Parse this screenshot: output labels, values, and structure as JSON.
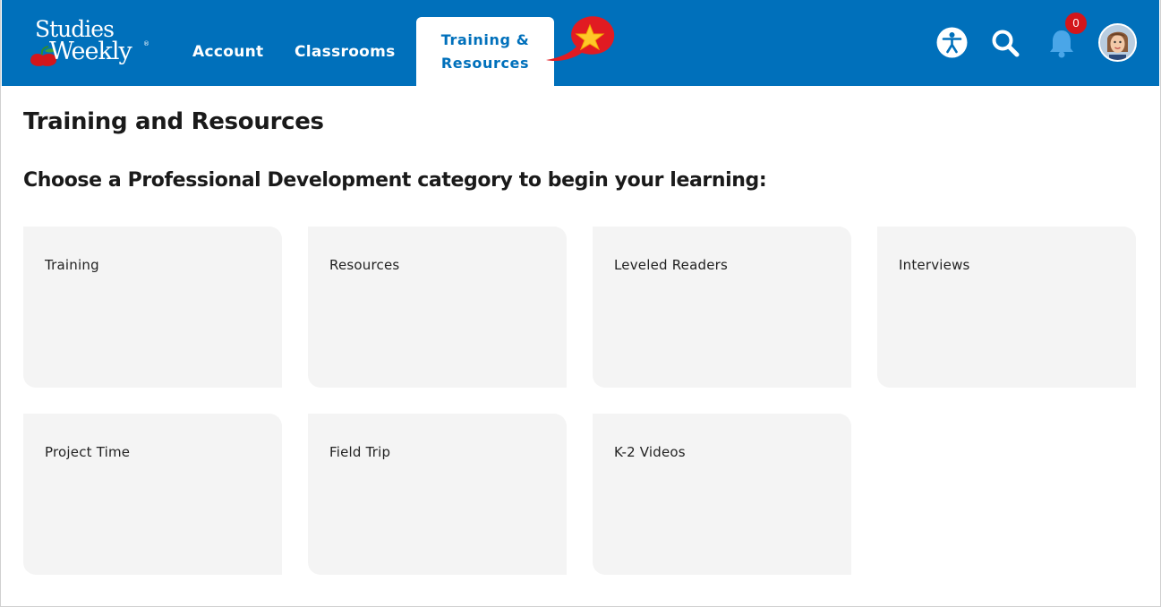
{
  "brand": {
    "line1": "Studies",
    "line2": "Weekly",
    "reg": "®",
    "header_color": "#0070bb"
  },
  "nav": {
    "account": "Account",
    "classrooms": "Classrooms",
    "active_line1": "Training &",
    "active_line2": "Resources"
  },
  "header_icons": {
    "accessibility": "accessibility-icon",
    "search": "search-icon",
    "notifications": "bell-icon",
    "notification_count": "0",
    "avatar": "user-avatar",
    "badge": "star-icon"
  },
  "page": {
    "title": "Training and Resources",
    "subtitle": "Choose a Professional Development category to begin your learning:"
  },
  "categories": [
    "Training",
    "Resources",
    "Leveled Readers",
    "Interviews",
    "Project Time",
    "Field Trip",
    "K-2 Videos"
  ]
}
